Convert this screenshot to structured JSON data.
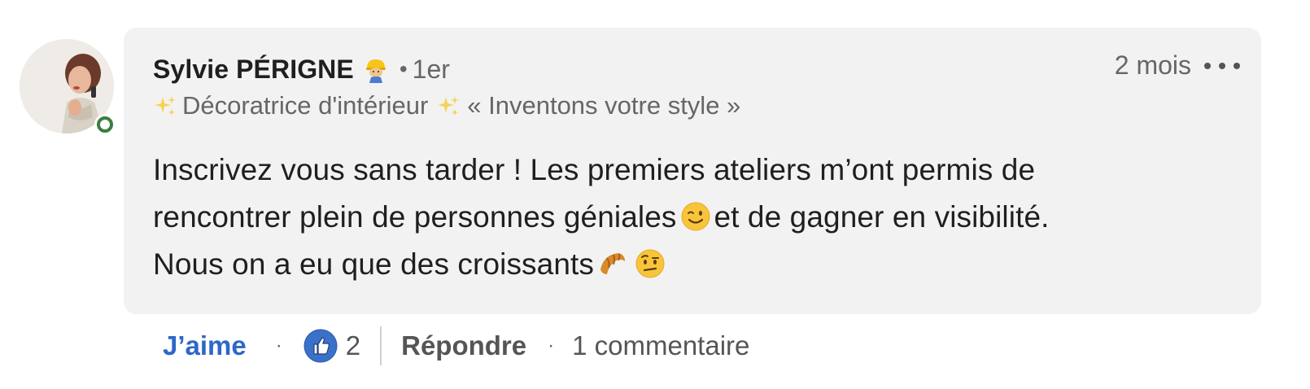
{
  "comment": {
    "author": {
      "name": "Sylvie PÉRIGNE",
      "badge_icon": "construction-worker-icon",
      "separator": "•",
      "connection_degree": "1er",
      "headline_prefix_icon": "sparkles-icon",
      "headline_text": "Décoratrice d'intérieur",
      "headline_suffix_icon": "sparkles-icon",
      "headline_tagline": "« Inventons votre style »",
      "online_status": "online",
      "status_color": "#3d7d3e"
    },
    "time_ago": "2 mois",
    "more_icon": "more-horizontal-icon",
    "body": {
      "line1": "Inscrivez vous sans tarder ! Les premiers ateliers m’ont permis de",
      "line2_before": "rencontrer plein de personnes géniales",
      "line2_emoji": "winking-face-icon",
      "line2_after": "et de gagner en visibilité.",
      "line3_text": "Nous on a eu que des croissants",
      "line3_emoji1": "croissant-icon",
      "line3_emoji2": "face-with-raised-eyebrow-icon"
    },
    "bubble_color": "#f2f2f2"
  },
  "actions": {
    "like_label": "J’aime",
    "dot": "·",
    "reaction_icon": "thumbs-up-icon",
    "reaction_count": "2",
    "reply_label": "Répondre",
    "comments_label": "1 commentaire",
    "accent_color": "#2e67c9"
  }
}
